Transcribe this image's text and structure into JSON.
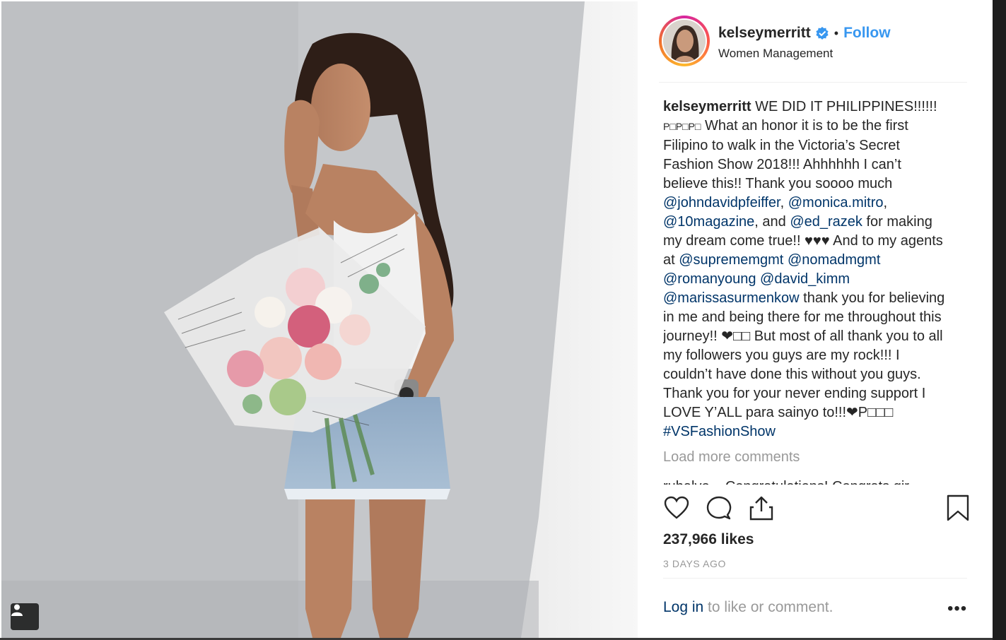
{
  "post": {
    "username": "kelseymerritt",
    "separator": "•",
    "follow_label": "Follow",
    "location": "Women Management"
  },
  "caption": {
    "username": "kelseymerritt",
    "t1": " WE DID IT PHILIPPINES!!!!!! ",
    "t2": "P□P□P□",
    "t3": " What an honor it is to be the first Filipino to walk in the Victoria’s Secret Fashion Show 2018!!! Ahhhhhh I can’t believe this!! Thank you soooo much ",
    "m1": "@johndavidpfeiffer",
    "t4": ", ",
    "m2": "@monica.mitro",
    "t5": ", ",
    "m3": "@10magazine",
    "t6": ", and ",
    "m4": "@ed_razek",
    "t7": " for making my dream come true!! ♥♥♥ And to my agents at ",
    "m5": "@suprememgmt",
    "t8": " ",
    "m6": "@nomadmgmt",
    "t9": " ",
    "m7": "@romanyoung",
    "t10": " ",
    "m8": "@david_kimm",
    "t11": " ",
    "m9": "@marissasurmenkow",
    "t12": " thank you for believing in me and being there for me throughout this journey!! ❤□□ But most of all thank you to all my followers you guys are my rock!!! I couldn’t have done this without you guys. Thank you for your never ending support I LOVE Y’ALL para sainyo to!!!❤P□□□ ",
    "m10": "#VSFashionShow"
  },
  "comments": {
    "load_more": "Load more comments",
    "partial_comment": "ruhalvo... Congratulations! Congrats gir"
  },
  "likes": "237,966 likes",
  "posted": "3 DAYS AGO",
  "footer": {
    "login": "Log in",
    "rest": " to like or comment.",
    "more": "•••"
  },
  "icons": {
    "like": "heart-icon",
    "comment": "comment-icon",
    "share": "share-icon",
    "save": "bookmark-icon",
    "verified": "verified-badge-icon",
    "user_tag": "user-tag-icon"
  },
  "colors": {
    "follow": "#3897f0",
    "mention": "#003569",
    "verified": "#3897f0",
    "muted": "#999999",
    "text": "#262626"
  }
}
